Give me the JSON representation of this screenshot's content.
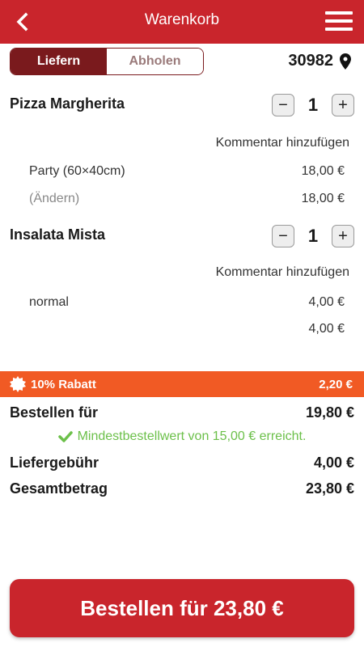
{
  "header": {
    "title": "Warenkorb",
    "back_icon": "chevron-left-icon",
    "menu_icon": "hamburger-menu-icon",
    "color": "#c9252c"
  },
  "delivery_toggle": {
    "options": [
      "Liefern",
      "Abholen"
    ],
    "selected": "Liefern"
  },
  "location": {
    "zip": "30982",
    "icon": "location-pin-icon"
  },
  "cart": {
    "items": [
      {
        "name": "Pizza Margherita",
        "quantity": "1",
        "comment_label": "Kommentar hinzufügen",
        "options": [
          {
            "label": "Party (60×40cm)",
            "price": "18,00 €"
          },
          {
            "label": "(Ändern)",
            "price": "18,00 €"
          }
        ]
      },
      {
        "name": "Insalata Mista",
        "quantity": "1",
        "comment_label": "Kommentar hinzufügen",
        "options": [
          {
            "label": "normal",
            "price": "4,00 €"
          },
          {
            "label": "",
            "price": "4,00 €"
          }
        ]
      }
    ]
  },
  "discount": {
    "label": "10% Rabatt",
    "value": "2,20 €",
    "color": "#f15a24",
    "icon": "badge-icon"
  },
  "summary": {
    "order_for_label": "Bestellen für",
    "order_for_value": "19,80 €",
    "min_order_notice": "Mindestbestellwert von 15,00 € erreicht.",
    "delivery_fee_label": "Liefergebühr",
    "delivery_fee_value": "4,00 €",
    "total_label": "Gesamtbetrag",
    "total_value": "23,80 €"
  },
  "order_button": {
    "label": "Bestellen für 23,80 €"
  }
}
